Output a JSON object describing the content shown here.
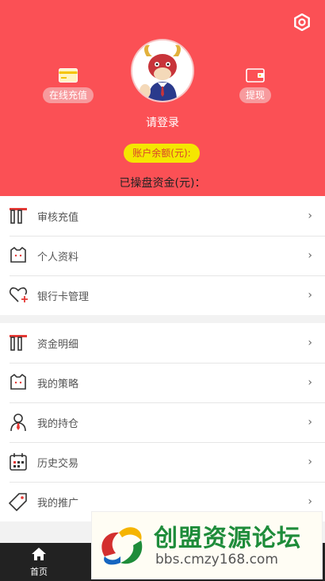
{
  "header": {
    "login_text": "请登录",
    "balance_label": "账户余额(元):",
    "funds_label": "已操盘资金(元)：",
    "recharge_label": "在线充值",
    "withdraw_label": "提现",
    "colors": {
      "background": "#fb5055",
      "balance_pill": "#f5e600",
      "balance_text": "#d9412c"
    }
  },
  "menu_group_1": [
    {
      "label": "审核充值",
      "icon": "card-icon"
    },
    {
      "label": "个人资料",
      "icon": "profile-icon"
    },
    {
      "label": "银行卡管理",
      "icon": "heart-plus-icon"
    }
  ],
  "menu_group_2": [
    {
      "label": "资金明细",
      "icon": "card-icon"
    },
    {
      "label": "我的策略",
      "icon": "strategy-icon"
    },
    {
      "label": "我的持仓",
      "icon": "user-tie-icon"
    },
    {
      "label": "历史交易",
      "icon": "calendar-icon"
    },
    {
      "label": "我的推广",
      "icon": "tag-icon"
    }
  ],
  "chevron": "›",
  "bottom_nav": {
    "home_label": "首页"
  },
  "watermark": {
    "title": "创盟资源论坛",
    "url": "bbs.cmzy168.com"
  }
}
